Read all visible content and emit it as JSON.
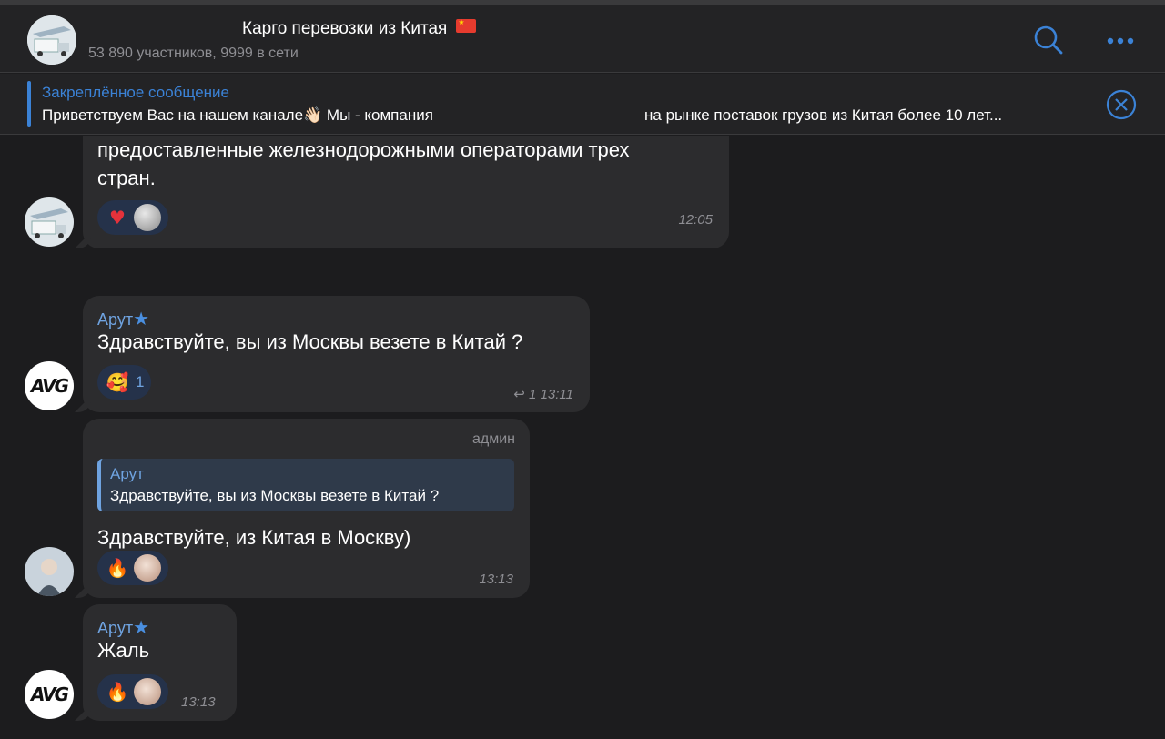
{
  "header": {
    "title": "Карго перевозки из Китая",
    "subtitle": "53 890 участников, 9999 в сети",
    "flag_icon": "china-flag",
    "accent_color": "#3b82d6"
  },
  "pinned": {
    "label": "Закреплённое сообщение",
    "text_start": "Приветствуем Вас на нашем канале👋🏻 Мы - компания",
    "text_end": "на рынке поставок грузов из Китая более 10 лет..."
  },
  "messages": [
    {
      "lines": [
        "предоставленные железнодорожными операторами трех",
        "стран."
      ],
      "reactions": [
        "heart",
        "avatar"
      ],
      "time": "12:05"
    },
    {
      "sender": "Арут",
      "text": "Здравствуйте, вы из Москвы везете в Китай ?",
      "reaction_emoji": "🥰",
      "reaction_count": "1",
      "replies": "1",
      "time": "13:11"
    },
    {
      "role": "админ",
      "quote_name": "Арут",
      "quote_text": "Здравствуйте, вы из Москвы везете в Китай ?",
      "text": "Здравствуйте, из Китая в Москву)",
      "reactions": [
        "fire",
        "avatar"
      ],
      "time": "13:13"
    },
    {
      "sender": "Арут",
      "text": "Жаль",
      "reactions": [
        "fire",
        "avatar"
      ],
      "time": "13:13"
    }
  ],
  "avatar_logo_text": "AVG"
}
